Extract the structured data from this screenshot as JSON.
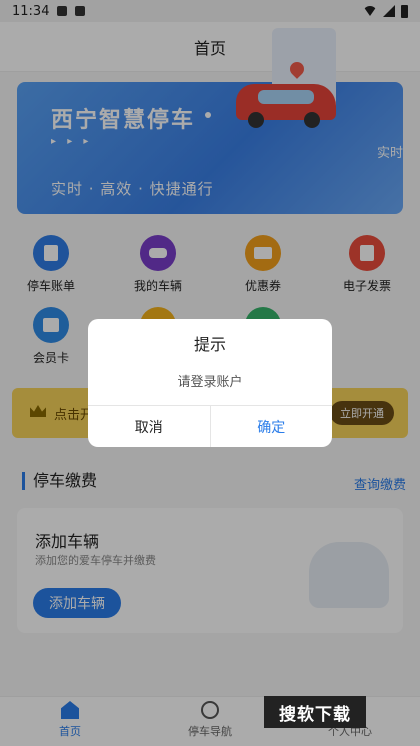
{
  "status_bar": {
    "time": "11:34"
  },
  "header": {
    "title": "首页"
  },
  "banner": {
    "title": "西宁智慧停车",
    "arrows": "▸ ▸ ▸",
    "subtitle": "实时 · 高效 · 快捷通行",
    "side_text": "实时"
  },
  "grid": {
    "items": [
      {
        "label": "停车账单",
        "icon": "bill-icon",
        "color": "#2f7de6"
      },
      {
        "label": "我的车辆",
        "icon": "car-icon",
        "color": "#7a3ec9"
      },
      {
        "label": "优惠券",
        "icon": "coupon-icon",
        "color": "#f4a01c"
      },
      {
        "label": "电子发票",
        "icon": "invoice-icon",
        "color": "#ea4c3d"
      },
      {
        "label": "会员卡",
        "icon": "member-card-icon",
        "color": "#2f8be6"
      }
    ]
  },
  "member_bar": {
    "text": "点击开",
    "button": "立即开通"
  },
  "section": {
    "title": "停车缴费",
    "link": "查询缴费"
  },
  "card": {
    "title": "添加车辆",
    "subtitle": "添加您的爱车停车并缴费",
    "button": "添加车辆"
  },
  "tabbar": {
    "items": [
      {
        "label": "首页",
        "icon": "home-icon",
        "active": true
      },
      {
        "label": "停车导航",
        "icon": "compass-icon",
        "active": false
      },
      {
        "label": "个人中心",
        "icon": "user-icon",
        "active": false
      }
    ]
  },
  "watermark": "搜软下载",
  "dialog": {
    "title": "提示",
    "message": "请登录账户",
    "cancel": "取消",
    "confirm": "确定"
  },
  "colors": {
    "accent": "#2b7de9",
    "member_bg": "#f7d25a"
  }
}
